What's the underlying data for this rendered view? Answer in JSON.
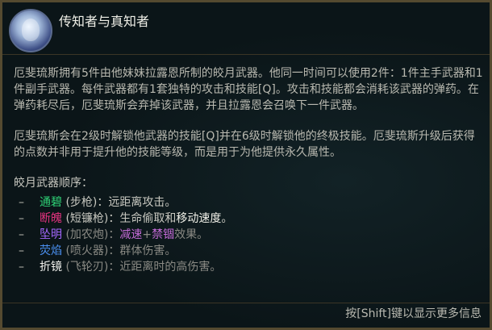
{
  "tooltip": {
    "title": "传知者与真知者",
    "paragraphs": [
      "厄斐琉斯拥有5件由他妹妹拉露恩所制的皎月武器。他同一时间可以使用2件：1件主手武器和1件副手武器。每件武器都有1套独特的攻击和技能[Q]。攻击和技能都会消耗该武器的弹药。在弹药耗尽后，厄斐琉斯会弃掉该武器，并且拉露恩会召唤下一件武器。",
      "厄斐琉斯会在2级时解锁他武器的技能[Q]并在6级时解锁他的终极技能。厄斐琉斯升级后获得的点数并非用于提升他的技能等级，而是用于为他提供永久属性。"
    ],
    "order_heading": "皎月武器顺序：",
    "weapons": [
      {
        "bullet": "–",
        "name": "通碧",
        "kind": " (步枪)：",
        "desc": "远距离攻击。"
      },
      {
        "bullet": "–",
        "name": "断魄",
        "kind": " (短镰枪)：",
        "desc_a": "生命偷取和",
        "desc_b": "移动速度",
        "desc_c": "。"
      },
      {
        "bullet": "–",
        "name": "坠明",
        "kind": " (加农炮)：",
        "desc_a": "减速",
        "desc_b": "+",
        "desc_c": "禁锢",
        "desc_d": "效果。"
      },
      {
        "bullet": "–",
        "name": "荧焰",
        "kind": " (喷火器)：",
        "desc": "群体伤害。"
      },
      {
        "bullet": "–",
        "name": "折镜",
        "kind": " (飞轮刃)：",
        "desc": "近距离时的高伤害。"
      }
    ],
    "footer_hint": "按[Shift]键以显示更多信息"
  },
  "icons": {
    "portrait": "aphelios-portrait-icon"
  },
  "colors": {
    "border": "#554a30",
    "background": "#0b1518",
    "weapon_green": "#2fd176",
    "weapon_red": "#e2337f",
    "weapon_purple": "#a567ff",
    "weapon_blue": "#4a8ff0",
    "weapon_white": "#f2f2ee"
  }
}
